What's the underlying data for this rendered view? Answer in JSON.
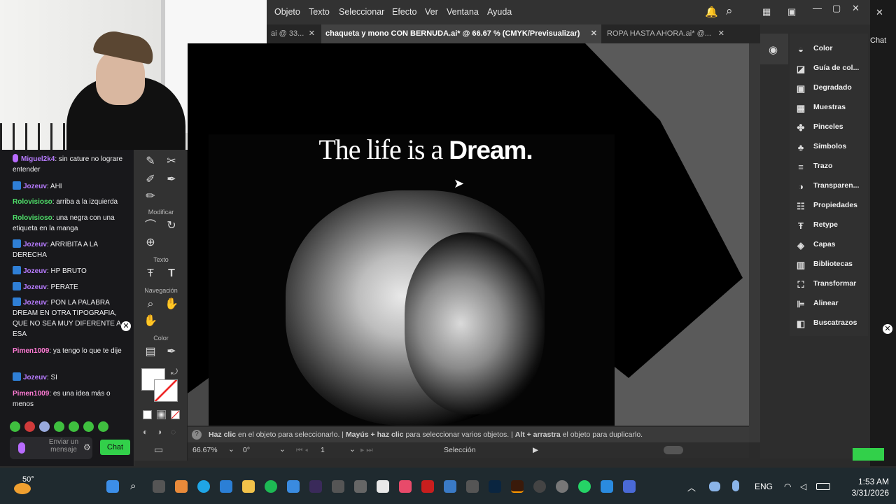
{
  "webcam": {
    "label": "webcam-feed"
  },
  "chat": {
    "messages": [
      {
        "user": "Miguel2k4",
        "text": ": sin cature no lograre entender",
        "style": "mic"
      },
      {
        "user": "Jozeuv",
        "text": ": AHI",
        "style": "badge"
      },
      {
        "user": "Rolovisioso",
        "text": ": arriba a la izquierda",
        "style": "green"
      },
      {
        "user": "Rolovisioso",
        "text": ": una negra con una etiqueta en la manga",
        "style": "green"
      },
      {
        "user": "Jozeuv",
        "text": ": ARRIBITA A LA DERECHA",
        "style": "badge"
      },
      {
        "user": "Jozeuv",
        "text": ": HP BRUTO",
        "style": "badge"
      },
      {
        "user": "Jozeuv",
        "text": ": PERATE",
        "style": "badge"
      },
      {
        "user": "Jozeuv",
        "text": ": PON LA PALABRA DREAM EN OTRA TIPOGRAFIA, QUE NO SEA MUY DIFERENTE A ESA",
        "style": "badge"
      },
      {
        "user": "Pimen1009",
        "text": ": ya tengo lo que te dije",
        "style": "pink"
      },
      {
        "user": "Jozeuv",
        "text": ": SI",
        "style": "badge"
      },
      {
        "user": "Pimen1009",
        "text": ": es una idea más o menos",
        "style": "pink"
      }
    ],
    "input_placeholder": "Enviar un mensaje",
    "send_label": "Chat"
  },
  "tools": {
    "modify_label": "Modificar",
    "text_label": "Texto",
    "nav_label": "Navegación",
    "color_label": "Color"
  },
  "menu": {
    "items": [
      "Objeto",
      "Texto",
      "Seleccionar",
      "Efecto",
      "Ver",
      "Ventana",
      "Ayuda"
    ]
  },
  "tabs": [
    {
      "label": "ai @ 33...",
      "active": false
    },
    {
      "label": "chaqueta y mono CON BERNUDA.ai* @ 66.67 % (CMYK/Previsualizar)",
      "active": true
    },
    {
      "label": "ROPA HASTA AHORA.ai* @...",
      "active": false
    }
  ],
  "canvas": {
    "headline_regular": "The life is a ",
    "headline_bold": "Dream."
  },
  "status": {
    "hint_1_strong": "Haz clic",
    "hint_1": " en el objeto para seleccionarlo.",
    "hint_2_strong": "Mayús + haz clic",
    "hint_2": " para seleccionar varios objetos.",
    "hint_3_strong": "Alt + arrastra",
    "hint_3": " el objeto para duplicarlo.",
    "zoom": "66.67%",
    "rotation": "0°",
    "artboard": "1",
    "tool": "Selección"
  },
  "panels": [
    {
      "label": "Color",
      "icon": "palette-icon"
    },
    {
      "label": "Guía de col...",
      "icon": "color-guide-icon"
    },
    {
      "label": "Degradado",
      "icon": "gradient-icon"
    },
    {
      "label": "Muestras",
      "icon": "swatches-icon"
    },
    {
      "label": "Pinceles",
      "icon": "brushes-icon"
    },
    {
      "label": "Símbolos",
      "icon": "symbols-icon"
    },
    {
      "label": "Trazo",
      "icon": "stroke-icon"
    },
    {
      "label": "Transparen...",
      "icon": "transparency-icon"
    },
    {
      "label": "Propiedades",
      "icon": "properties-icon"
    },
    {
      "label": "Retype",
      "icon": "retype-icon"
    },
    {
      "label": "Capas",
      "icon": "layers-icon"
    },
    {
      "label": "Bibliotecas",
      "icon": "libraries-icon"
    },
    {
      "label": "Transformar",
      "icon": "transform-icon"
    },
    {
      "label": "Alinear",
      "icon": "align-icon"
    },
    {
      "label": "Buscatrazos",
      "icon": "pathfinder-icon"
    }
  ],
  "rightstrip": {
    "chat_label": "Chat"
  },
  "taskbar": {
    "weather": "50°",
    "lang": "ENG",
    "time": "1:53 AM",
    "date": "3/31/2026"
  }
}
